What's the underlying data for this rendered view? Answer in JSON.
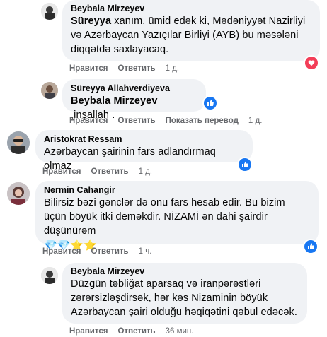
{
  "colors": {
    "bubble": "#f0f2f5",
    "meta": "#65676b",
    "like_blue": "#1877f2",
    "love_red": "#f33e58"
  },
  "comments": [
    {
      "author": "Beybala Mirzeyev",
      "mention": "Süreyya",
      "text": " xanım, ümid edək ki, Mədəniyyət Nazirliyi və Azərbaycan Yazıçılar Birliyi (AYB) bu məsələni diqqətdə saxlayacaq.",
      "like": "Нравится",
      "reply": "Ответить",
      "time": "1 д.",
      "reaction_icon": "love-reaction-icon"
    },
    {
      "author": "Süreyya Allahverdiyeva",
      "mention": "Beybala Mirzeyev",
      "text": " ,inşallah .",
      "like": "Нравится",
      "reply": "Ответить",
      "translate": "Показать перевод",
      "time": "1 д.",
      "reaction_icon": "like-reaction-icon"
    },
    {
      "author": "Aristokrat Ressam",
      "text": "Azərbaycan şairinin fars adlandırmaq olmaz",
      "like": "Нравится",
      "reply": "Ответить",
      "time": "1 д.",
      "reaction_icon": "like-reaction-icon"
    },
    {
      "author": "Nermin Cahangir",
      "text": "Bilirsiz bəzi gənclər də onu fars hesab edir. Bu bizim üçün böyük itki deməkdir. NİZAMİ ən dahi şairdir düşünürəm",
      "emojis": "💎💎⭐⭐",
      "like": "Нравится",
      "reply": "Ответить",
      "time": "1 ч.",
      "reaction_icon": "like-reaction-icon"
    },
    {
      "author": "Beybala Mirzeyev",
      "text": "Düzgün təbliğat aparsaq və iranpərəstləri zərərsizləşdirsək, hər kəs Nizaminin böyük Azərbaycan şairi olduğu həqiqətini qəbul edəcək.",
      "like": "Нравится",
      "reply": "Ответить",
      "time": "36 мин."
    }
  ]
}
